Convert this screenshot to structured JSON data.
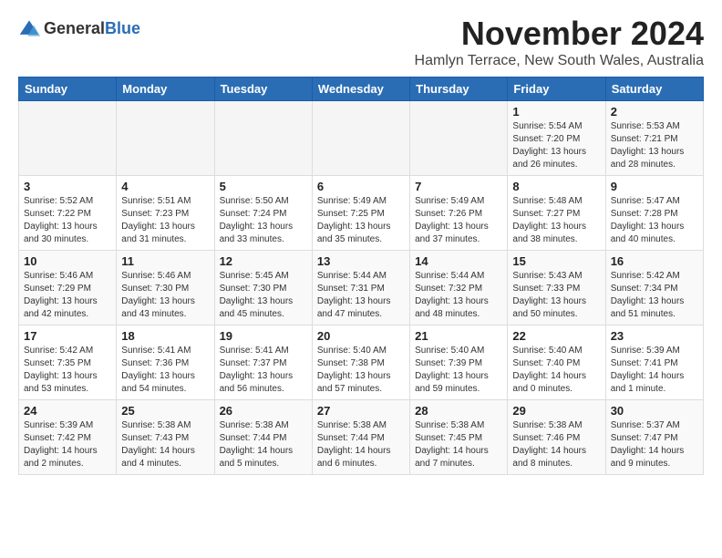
{
  "logo": {
    "general": "General",
    "blue": "Blue"
  },
  "header": {
    "month": "November 2024",
    "location": "Hamlyn Terrace, New South Wales, Australia"
  },
  "weekdays": [
    "Sunday",
    "Monday",
    "Tuesday",
    "Wednesday",
    "Thursday",
    "Friday",
    "Saturday"
  ],
  "weeks": [
    [
      {
        "day": "",
        "info": ""
      },
      {
        "day": "",
        "info": ""
      },
      {
        "day": "",
        "info": ""
      },
      {
        "day": "",
        "info": ""
      },
      {
        "day": "",
        "info": ""
      },
      {
        "day": "1",
        "info": "Sunrise: 5:54 AM\nSunset: 7:20 PM\nDaylight: 13 hours\nand 26 minutes."
      },
      {
        "day": "2",
        "info": "Sunrise: 5:53 AM\nSunset: 7:21 PM\nDaylight: 13 hours\nand 28 minutes."
      }
    ],
    [
      {
        "day": "3",
        "info": "Sunrise: 5:52 AM\nSunset: 7:22 PM\nDaylight: 13 hours\nand 30 minutes."
      },
      {
        "day": "4",
        "info": "Sunrise: 5:51 AM\nSunset: 7:23 PM\nDaylight: 13 hours\nand 31 minutes."
      },
      {
        "day": "5",
        "info": "Sunrise: 5:50 AM\nSunset: 7:24 PM\nDaylight: 13 hours\nand 33 minutes."
      },
      {
        "day": "6",
        "info": "Sunrise: 5:49 AM\nSunset: 7:25 PM\nDaylight: 13 hours\nand 35 minutes."
      },
      {
        "day": "7",
        "info": "Sunrise: 5:49 AM\nSunset: 7:26 PM\nDaylight: 13 hours\nand 37 minutes."
      },
      {
        "day": "8",
        "info": "Sunrise: 5:48 AM\nSunset: 7:27 PM\nDaylight: 13 hours\nand 38 minutes."
      },
      {
        "day": "9",
        "info": "Sunrise: 5:47 AM\nSunset: 7:28 PM\nDaylight: 13 hours\nand 40 minutes."
      }
    ],
    [
      {
        "day": "10",
        "info": "Sunrise: 5:46 AM\nSunset: 7:29 PM\nDaylight: 13 hours\nand 42 minutes."
      },
      {
        "day": "11",
        "info": "Sunrise: 5:46 AM\nSunset: 7:30 PM\nDaylight: 13 hours\nand 43 minutes."
      },
      {
        "day": "12",
        "info": "Sunrise: 5:45 AM\nSunset: 7:30 PM\nDaylight: 13 hours\nand 45 minutes."
      },
      {
        "day": "13",
        "info": "Sunrise: 5:44 AM\nSunset: 7:31 PM\nDaylight: 13 hours\nand 47 minutes."
      },
      {
        "day": "14",
        "info": "Sunrise: 5:44 AM\nSunset: 7:32 PM\nDaylight: 13 hours\nand 48 minutes."
      },
      {
        "day": "15",
        "info": "Sunrise: 5:43 AM\nSunset: 7:33 PM\nDaylight: 13 hours\nand 50 minutes."
      },
      {
        "day": "16",
        "info": "Sunrise: 5:42 AM\nSunset: 7:34 PM\nDaylight: 13 hours\nand 51 minutes."
      }
    ],
    [
      {
        "day": "17",
        "info": "Sunrise: 5:42 AM\nSunset: 7:35 PM\nDaylight: 13 hours\nand 53 minutes."
      },
      {
        "day": "18",
        "info": "Sunrise: 5:41 AM\nSunset: 7:36 PM\nDaylight: 13 hours\nand 54 minutes."
      },
      {
        "day": "19",
        "info": "Sunrise: 5:41 AM\nSunset: 7:37 PM\nDaylight: 13 hours\nand 56 minutes."
      },
      {
        "day": "20",
        "info": "Sunrise: 5:40 AM\nSunset: 7:38 PM\nDaylight: 13 hours\nand 57 minutes."
      },
      {
        "day": "21",
        "info": "Sunrise: 5:40 AM\nSunset: 7:39 PM\nDaylight: 13 hours\nand 59 minutes."
      },
      {
        "day": "22",
        "info": "Sunrise: 5:40 AM\nSunset: 7:40 PM\nDaylight: 14 hours\nand 0 minutes."
      },
      {
        "day": "23",
        "info": "Sunrise: 5:39 AM\nSunset: 7:41 PM\nDaylight: 14 hours\nand 1 minute."
      }
    ],
    [
      {
        "day": "24",
        "info": "Sunrise: 5:39 AM\nSunset: 7:42 PM\nDaylight: 14 hours\nand 2 minutes."
      },
      {
        "day": "25",
        "info": "Sunrise: 5:38 AM\nSunset: 7:43 PM\nDaylight: 14 hours\nand 4 minutes."
      },
      {
        "day": "26",
        "info": "Sunrise: 5:38 AM\nSunset: 7:44 PM\nDaylight: 14 hours\nand 5 minutes."
      },
      {
        "day": "27",
        "info": "Sunrise: 5:38 AM\nSunset: 7:44 PM\nDaylight: 14 hours\nand 6 minutes."
      },
      {
        "day": "28",
        "info": "Sunrise: 5:38 AM\nSunset: 7:45 PM\nDaylight: 14 hours\nand 7 minutes."
      },
      {
        "day": "29",
        "info": "Sunrise: 5:38 AM\nSunset: 7:46 PM\nDaylight: 14 hours\nand 8 minutes."
      },
      {
        "day": "30",
        "info": "Sunrise: 5:37 AM\nSunset: 7:47 PM\nDaylight: 14 hours\nand 9 minutes."
      }
    ]
  ]
}
